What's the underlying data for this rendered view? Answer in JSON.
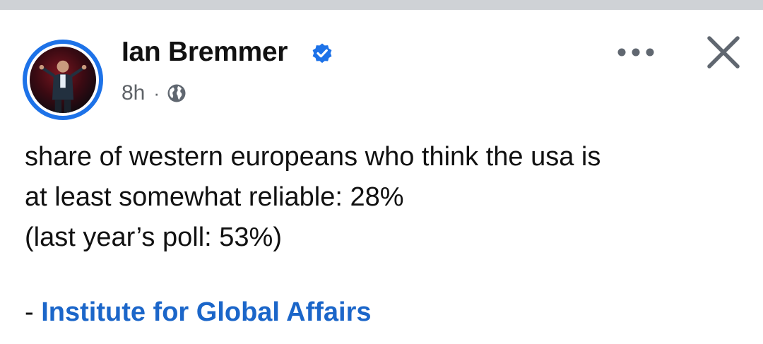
{
  "post": {
    "author": {
      "name": "Ian Bremmer",
      "verified": true,
      "avatar_icon": "profile-photo"
    },
    "meta": {
      "time": "8h",
      "separator": "·",
      "audience_icon": "globe-icon"
    },
    "actions": {
      "more_icon": "ellipsis-icon",
      "close_icon": "close-icon"
    },
    "body": {
      "lines": [
        "share of western europeans who think the usa is",
        "at least somewhat reliable: 28%",
        "(last year’s poll: 53%)"
      ],
      "source_prefix": "- ",
      "source_link": "Institute for Global Affairs"
    }
  },
  "colors": {
    "accent": "#1d72e8",
    "link": "#1b66c9",
    "text": "#111111",
    "muted": "#5f6368",
    "icon": "#606770"
  }
}
